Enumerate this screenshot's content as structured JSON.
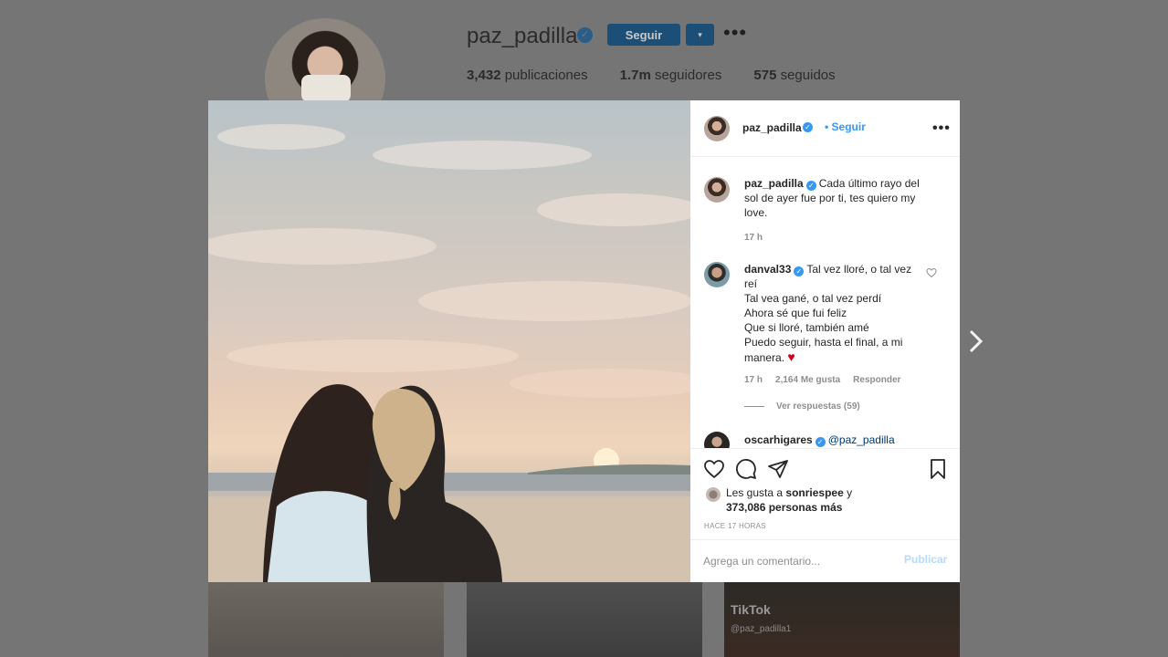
{
  "profile": {
    "username": "paz_padilla",
    "follow_label": "Seguir",
    "dropdown_icon": "▾",
    "more_icon": "•••",
    "stats": [
      {
        "value": "3,432",
        "label": "publicaciones"
      },
      {
        "value": "1.7m",
        "label": "seguidores"
      },
      {
        "value": "575",
        "label": "seguidos"
      }
    ]
  },
  "grid": {
    "tiktok_label": "TikTok",
    "tiktok_user": "@paz_padilla1"
  },
  "post": {
    "dots_count": 5,
    "active_dot": 0,
    "header": {
      "username": "paz_padilla",
      "follow_link": "• Seguir",
      "more_icon": "•••"
    },
    "caption": {
      "username": "paz_padilla",
      "line1": "Cada último rayo del",
      "line2": "sol de ayer fue por ti, tes quiero my",
      "line3": "love.",
      "time": "17 h"
    },
    "comments": [
      {
        "username": "danval33",
        "lines": [
          "Tal vez lloré, o tal vez",
          "reí",
          "Tal vea gané, o tal vez perdí",
          "Ahora sé que fui feliz",
          "Que si lloré, también amé",
          "Puedo seguir, hasta el final, a mi",
          "manera."
        ],
        "emoji": "♥",
        "time": "17 h",
        "likes": "2,164 Me gusta",
        "reply": "Responder",
        "view_replies": "Ver respuestas (59)"
      },
      {
        "username": "oscarhigares",
        "text": "@paz_padilla"
      }
    ],
    "likes": {
      "prefix": "Les gusta a",
      "user": "sonriespee",
      "conj": "y",
      "count": "373,086 personas más"
    },
    "time_ago": "HACE 17 HORAS",
    "comment_placeholder": "Agrega un comentario...",
    "publish_label": "Publicar"
  },
  "colors": {
    "accent": "#3897f0",
    "heart": "#ed4956",
    "overlay": "#757575"
  }
}
